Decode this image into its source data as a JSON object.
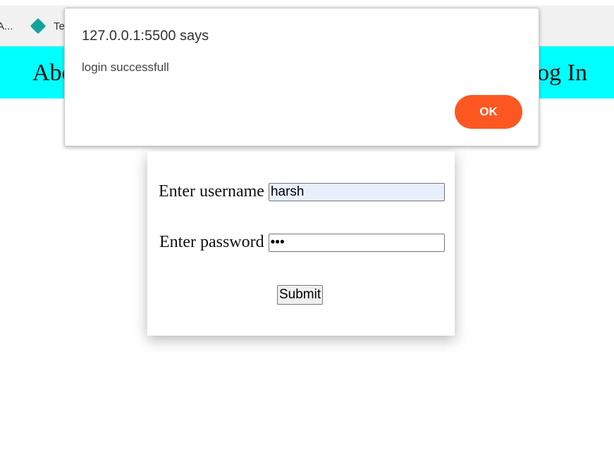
{
  "bookmarks": [
    {
      "label": "A..."
    },
    {
      "label": "Te",
      "icon": "diamond-icon",
      "icon_color": "#14a39a"
    }
  ],
  "navbar": {
    "background": "#00ffff",
    "about_label": "Abo",
    "login_label": "og In"
  },
  "login_form": {
    "username_label": "Enter username",
    "username_value": "harsh",
    "password_label": "Enter password",
    "password_value": "•••",
    "submit_label": "Submit"
  },
  "alert": {
    "title": "127.0.0.1:5500 says",
    "message": "login successfull",
    "ok_label": "OK",
    "ok_color": "#ff5722"
  }
}
